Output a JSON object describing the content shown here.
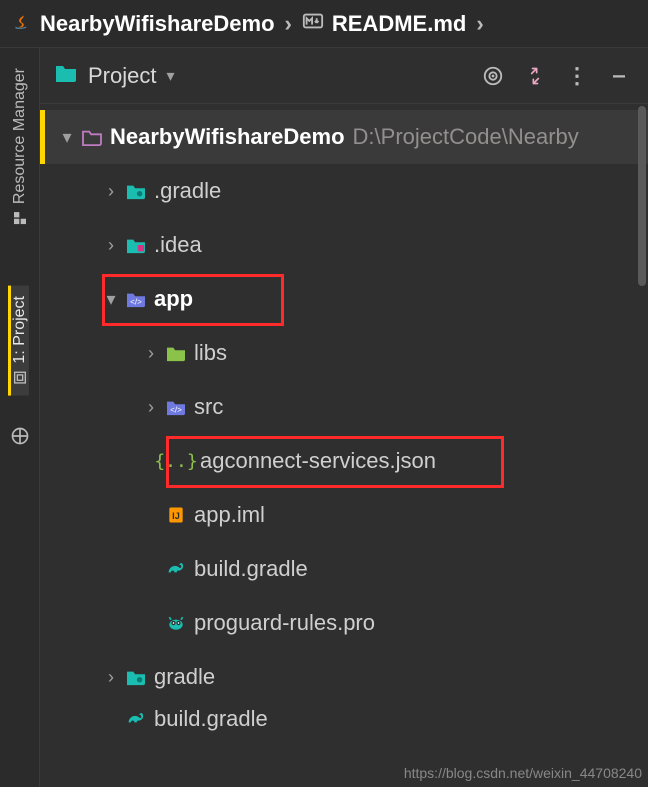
{
  "breadcrumb": {
    "project": "NearbyWifishareDemo",
    "file": "README.md"
  },
  "side_tabs": {
    "resource_manager": "Resource Manager",
    "project": "1: Project"
  },
  "panel": {
    "selector": "Project"
  },
  "tree": {
    "root": {
      "name": "NearbyWifishareDemo",
      "path": "D:\\ProjectCode\\Nearby"
    },
    "gradle_dir": ".gradle",
    "idea_dir": ".idea",
    "app_dir": "app",
    "libs_dir": "libs",
    "src_dir": "src",
    "agconnect": "agconnect-services.json",
    "app_iml": "app.iml",
    "build_gradle_app": "build.gradle",
    "proguard": "proguard-rules.pro",
    "gradle_dir2": "gradle",
    "build_gradle_root": "build.gradle"
  },
  "watermark": "https://blog.csdn.net/weixin_44708240"
}
